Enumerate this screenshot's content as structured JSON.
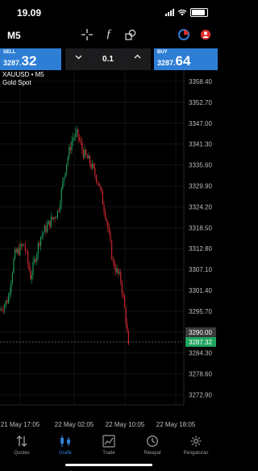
{
  "status": {
    "time": "19.09"
  },
  "toolbar": {
    "timeframe": "M5",
    "icons": [
      "crosshair-icon",
      "function-icon",
      "shapes-icon",
      "record-icon",
      "profile-icon"
    ]
  },
  "trade": {
    "sell_label": "SELL",
    "sell_price_small": "3287.",
    "sell_price_big": "32",
    "buy_label": "BUY",
    "buy_price_small": "3287.",
    "buy_price_big": "64",
    "lot": "0.1"
  },
  "chart": {
    "symbol": "XAUUSD • M5",
    "description": "Gold Spot",
    "current_price": "3287.32",
    "current_price_value": 3287.32,
    "price_level_label": "3290.00",
    "price_level_value": 3290.0,
    "y_ticks": [
      "3358.40",
      "3352.70",
      "3347.00",
      "3341.30",
      "3335.60",
      "3329.90",
      "3324.20",
      "3318.50",
      "3312.80",
      "3307.10",
      "3301.40",
      "3295.70",
      "3290.00",
      "3284.30",
      "3278.60",
      "3272.90"
    ],
    "x_ticks": [
      "21 May 17:05",
      "22 May 02:05",
      "22 May 10:05",
      "22 May 18:05"
    ],
    "colors": {
      "bull": "#1a9a5a",
      "bear": "#c8262f",
      "grid": "#1f1f1f",
      "accent": "#2e7ed6",
      "price_box": "#1fa45f"
    }
  },
  "tabs": [
    {
      "label": "Quotes",
      "icon": "quotes-icon",
      "active": false
    },
    {
      "label": "Grafik",
      "icon": "chart-icon",
      "active": true
    },
    {
      "label": "Trade",
      "icon": "trade-icon",
      "active": false
    },
    {
      "label": "Riwayat",
      "icon": "history-icon",
      "active": false
    },
    {
      "label": "Pengaturan",
      "icon": "settings-icon",
      "active": false
    }
  ]
}
